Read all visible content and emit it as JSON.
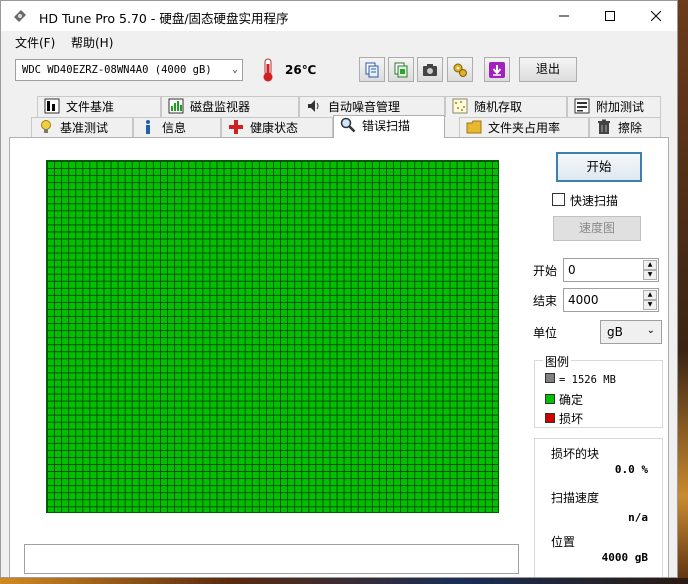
{
  "window": {
    "title": "HD Tune Pro 5.70 - 硬盘/固态硬盘实用程序"
  },
  "menu": {
    "file": "文件(F)",
    "help": "帮助(H)"
  },
  "toolbar": {
    "drive": "WDC WD40EZRZ-08WN4A0 (4000 gB)",
    "temperature": "26℃",
    "exit_label": "退出",
    "icons": [
      "copy-text-icon",
      "copy-screenshot-icon",
      "camera-icon",
      "options-icon",
      "save-icon"
    ]
  },
  "tabs_row1": [
    {
      "label": "文件基准",
      "icon": "file-benchmark-icon"
    },
    {
      "label": "磁盘监视器",
      "icon": "disk-monitor-icon"
    },
    {
      "label": "自动噪音管理",
      "icon": "speaker-icon"
    },
    {
      "label": "随机存取",
      "icon": "random-access-icon"
    },
    {
      "label": "附加测试",
      "icon": "extra-tests-icon"
    }
  ],
  "tabs_row2": [
    {
      "label": "基准测试",
      "icon": "benchmark-icon"
    },
    {
      "label": "信息",
      "icon": "info-icon"
    },
    {
      "label": "健康状态",
      "icon": "health-icon"
    },
    {
      "label": "错误扫描",
      "icon": "magnifier-icon",
      "active": true
    },
    {
      "label": "文件夹占用率",
      "icon": "folder-icon"
    },
    {
      "label": "擦除",
      "icon": "trash-icon"
    }
  ],
  "scan": {
    "start_button": "开始",
    "quick_scan_label": "快速扫描",
    "quick_scan_checked": false,
    "speed_map_button": "速度图",
    "start_label": "开始",
    "start_value": "0",
    "end_label": "结束",
    "end_value": "4000",
    "unit_label": "单位",
    "unit_value": "gB",
    "legend_title": "图例",
    "legend": [
      {
        "label": "= 1526 MB",
        "color": "#808080"
      },
      {
        "label": "确定",
        "color": "#00c000"
      },
      {
        "label": "损坏",
        "color": "#d00000"
      }
    ],
    "damaged_blocks_label": "损坏的块",
    "damaged_blocks_value": "0.0 %",
    "scan_speed_label": "扫描速度",
    "scan_speed_value": "n/a",
    "position_label": "位置",
    "position_value": "4000 gB"
  },
  "colors": {
    "ok_block": "#00c000",
    "damaged_block": "#d00000",
    "accent": "#3c7fb1"
  }
}
